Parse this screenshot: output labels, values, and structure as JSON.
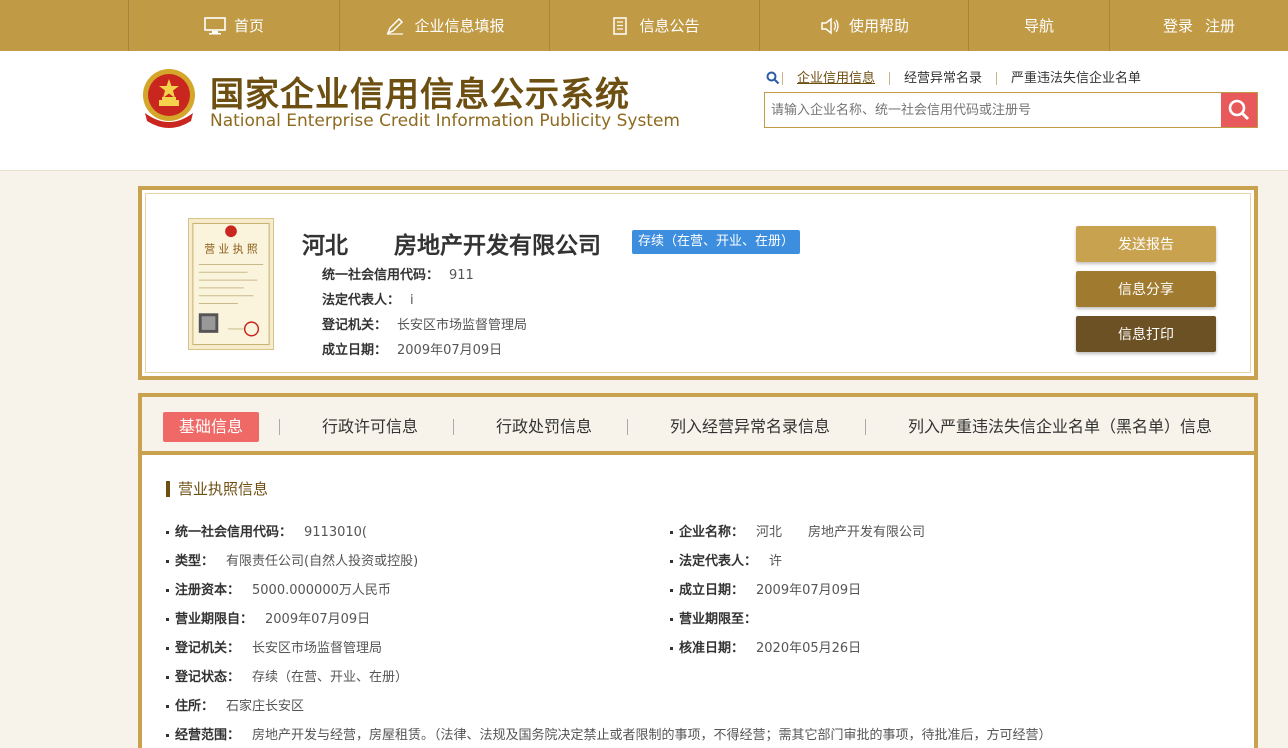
{
  "topnav": {
    "items": [
      {
        "label": "首页",
        "icon": "monitor-icon"
      },
      {
        "label": "企业信息填报",
        "icon": "pen-icon"
      },
      {
        "label": "信息公告",
        "icon": "document-icon"
      },
      {
        "label": "使用帮助",
        "icon": "speaker-icon"
      },
      {
        "label": "导航",
        "icon": ""
      }
    ],
    "login": "登录",
    "register": "注册"
  },
  "header": {
    "title_cn": "国家企业信用信息公示系统",
    "title_en": "National Enterprise Credit Information Publicity System",
    "search_tabs": [
      "企业信用信息",
      "经营异常名录",
      "严重违法失信企业名单"
    ],
    "search_placeholder": "请输入企业名称、统一社会信用代码或注册号"
  },
  "company": {
    "name": "河北　　房地产开发有限公司",
    "status": "存续（在营、开业、在册）",
    "fields": [
      {
        "key": "统一社会信用代码：",
        "value": "911"
      },
      {
        "key": "法定代表人：",
        "value": "i"
      },
      {
        "key": "登记机关：",
        "value": "长安区市场监督管理局"
      },
      {
        "key": "成立日期：",
        "value": "2009年07月09日"
      }
    ],
    "actions": [
      "发送报告",
      "信息分享",
      "信息打印"
    ]
  },
  "tabs": [
    "基础信息",
    "行政许可信息",
    "行政处罚信息",
    "列入经营异常名录信息",
    "列入严重违法失信企业名单（黑名单）信息"
  ],
  "license_section": {
    "title": "营业执照信息",
    "left_fields": [
      {
        "key": "统一社会信用代码：",
        "value": "9113010("
      },
      {
        "key": "类型：",
        "value": "有限责任公司(自然人投资或控股)"
      },
      {
        "key": "注册资本：",
        "value": "5000.000000万人民币"
      },
      {
        "key": "营业期限自：",
        "value": "2009年07月09日"
      },
      {
        "key": "登记机关：",
        "value": "长安区市场监督管理局"
      },
      {
        "key": "登记状态：",
        "value": "存续（在营、开业、在册）"
      },
      {
        "key": "住所：",
        "value": "石家庄长安区"
      },
      {
        "key": "经营范围：",
        "value": "房地产开发与经营，房屋租赁。（法律、法规及国务院决定禁止或者限制的事项，不得经营；需其它部门审批的事项，待批准后，方可经营）"
      }
    ],
    "right_fields": [
      {
        "key": "企业名称：",
        "value": "河北　　房地产开发有限公司"
      },
      {
        "key": "法定代表人：",
        "value": "许"
      },
      {
        "key": "成立日期：",
        "value": "2009年07月09日"
      },
      {
        "key": "营业期限至：",
        "value": ""
      },
      {
        "key": "核准日期：",
        "value": "2020年05月26日"
      }
    ]
  },
  "colors": {
    "nav_gold": "#c19a45",
    "brand_brown": "#6e4f12",
    "border_gold": "#c9a24f",
    "status_blue": "#3e8ee0",
    "tab_active": "#ef6a67",
    "search_button": "#e8595b",
    "btn_report": "#c9a24f",
    "btn_share": "#a07a2e",
    "btn_print": "#6b5124"
  }
}
